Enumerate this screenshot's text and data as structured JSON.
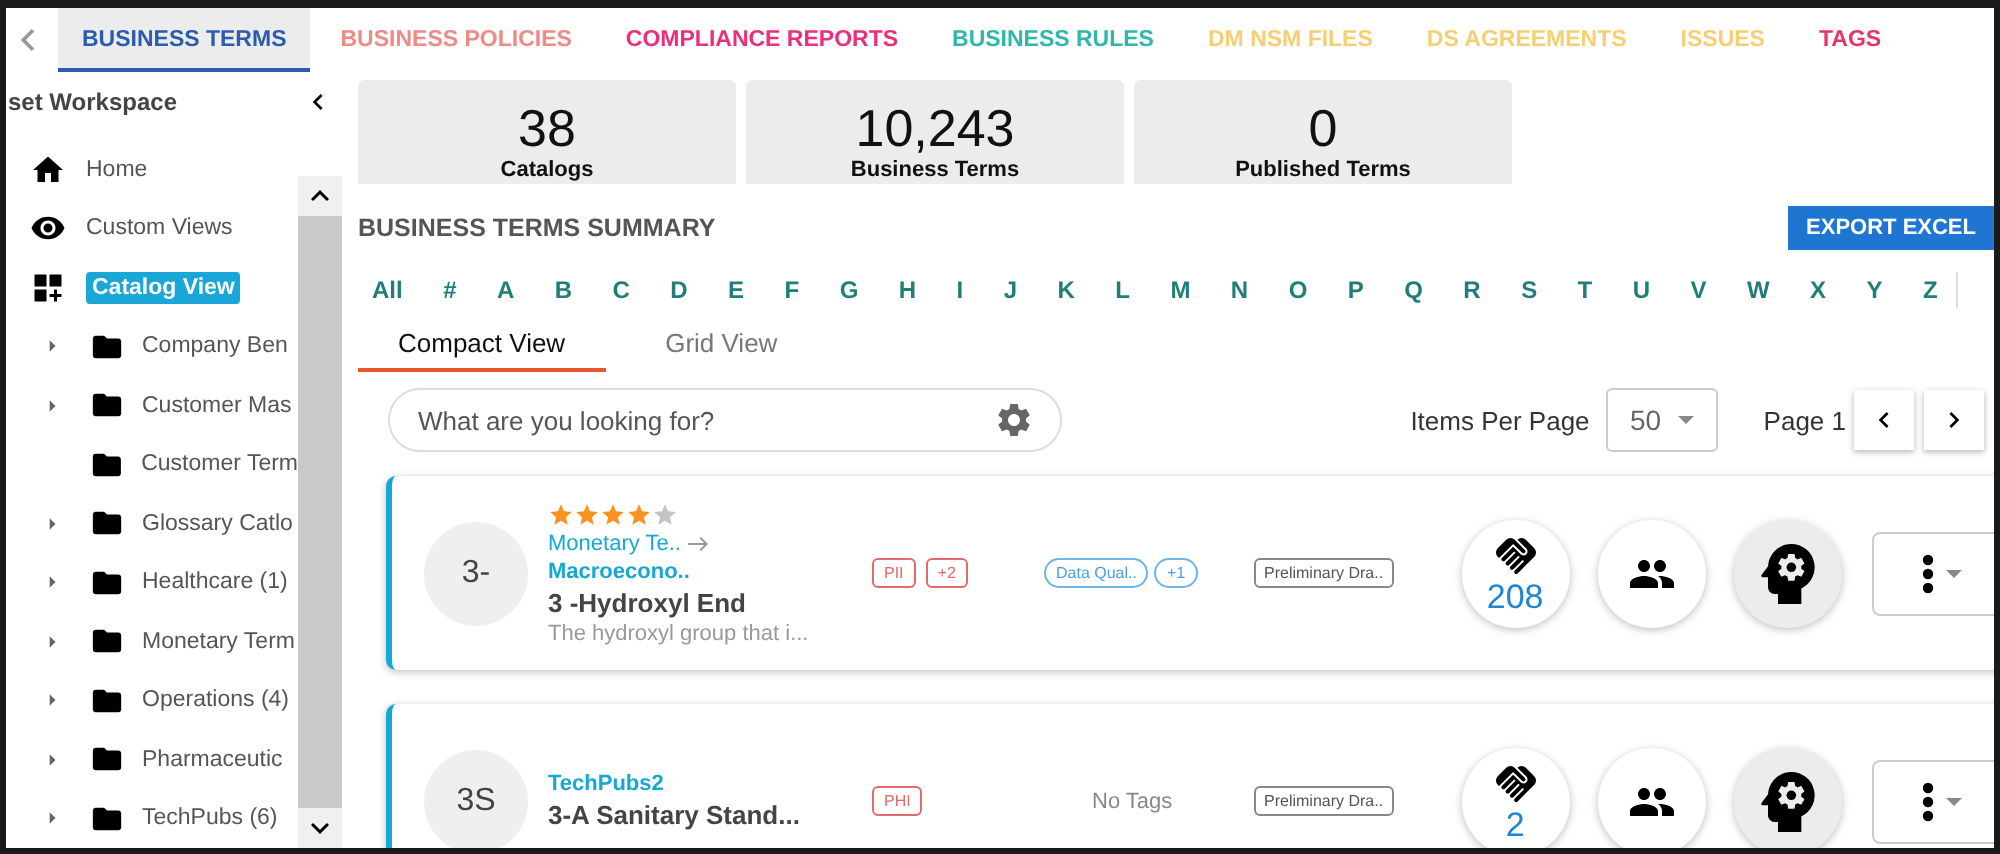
{
  "tabs": [
    {
      "label": "BUSINESS TERMS",
      "color": "#2a5db0",
      "selected": true
    },
    {
      "label": "BUSINESS POLICIES",
      "color": "#f08a86",
      "selected": false
    },
    {
      "label": "COMPLIANCE REPORTS",
      "color": "#ec2f7c",
      "selected": false
    },
    {
      "label": "BUSINESS RULES",
      "color": "#2fb8aa",
      "selected": false
    },
    {
      "label": "DM NSM FILES",
      "color": "#f6cf72",
      "selected": false
    },
    {
      "label": "DS AGREEMENTS",
      "color": "#f6cf72",
      "selected": false
    },
    {
      "label": "ISSUES",
      "color": "#f6cf72",
      "selected": false
    },
    {
      "label": "TAGS",
      "color": "#e8336b",
      "selected": false
    }
  ],
  "sidebar": {
    "title": "set Workspace",
    "nav": [
      {
        "kind": "home",
        "label": "Home",
        "selected": false
      },
      {
        "kind": "views",
        "label": "Custom Views",
        "selected": false
      },
      {
        "kind": "catalog",
        "label": "Catalog View",
        "selected": true
      }
    ],
    "tree": [
      {
        "label": "Company Ben",
        "has_children": true
      },
      {
        "label": "Customer Mas",
        "has_children": true
      },
      {
        "label": "Customer Term",
        "has_children": false
      },
      {
        "label": "Glossary Catlo",
        "has_children": true
      },
      {
        "label": "Healthcare (1)",
        "has_children": true
      },
      {
        "label": "Monetary Term",
        "has_children": true
      },
      {
        "label": "Operations (4)",
        "has_children": true
      },
      {
        "label": "Pharmaceutic",
        "has_children": true
      },
      {
        "label": "TechPubs (6)",
        "has_children": true
      }
    ]
  },
  "stats": [
    {
      "value": "38",
      "label": "Catalogs"
    },
    {
      "value": "10,243",
      "label": "Business Terms"
    },
    {
      "value": "0",
      "label": "Published Terms"
    }
  ],
  "summary_title": "BUSINESS TERMS SUMMARY",
  "export_button": "EXPORT EXCEL",
  "alphabet": [
    "All",
    "#",
    "A",
    "B",
    "C",
    "D",
    "E",
    "F",
    "G",
    "H",
    "I",
    "J",
    "K",
    "L",
    "M",
    "N",
    "O",
    "P",
    "Q",
    "R",
    "S",
    "T",
    "U",
    "V",
    "W",
    "X",
    "Y",
    "Z"
  ],
  "view_tabs": [
    {
      "label": "Compact View",
      "selected": true
    },
    {
      "label": "Grid View",
      "selected": false
    }
  ],
  "search": {
    "placeholder": "What are you looking for?"
  },
  "pagination": {
    "items_per_page_label": "Items Per Page",
    "per_page": "50",
    "page_label": "Page 1"
  },
  "cards": [
    {
      "initials": "3-",
      "stars": 4,
      "parent": "Monetary Te..",
      "catalog": "Macroecono..",
      "title": "3 -Hydroxyl End",
      "description": "The hydroxyl group that i...",
      "classifications": [
        "PII",
        "+2"
      ],
      "tags": [
        "Data Qual..",
        "+1"
      ],
      "status": "Preliminary Dra..",
      "relations": "208"
    },
    {
      "initials": "3S",
      "catalog": "TechPubs2",
      "title": "3-A Sanitary Stand...",
      "classifications": [
        "PHI"
      ],
      "no_tags_text": "No Tags",
      "status": "Preliminary Dra..",
      "relations": "2"
    }
  ]
}
